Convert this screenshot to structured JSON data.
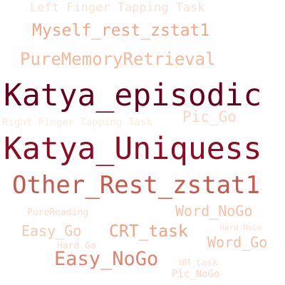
{
  "words": [
    {
      "text": "Left Finger Tapping Task",
      "color": "#fde2d3"
    },
    {
      "text": "Myself_rest_zstat1",
      "color": "#f2a587"
    },
    {
      "text": "PureMemoryRetrieval",
      "color": "#f5b89b"
    },
    {
      "text": "Katya_episodic",
      "color": "#67001f"
    },
    {
      "text": "Right Finger Tapping Task",
      "color": "#fde9df"
    },
    {
      "text": "Pic_Go",
      "color": "#fbd7c5"
    },
    {
      "text": "Katya_Uniquess",
      "color": "#8b0c23"
    },
    {
      "text": "Other_Rest_zstat1",
      "color": "#c6584b"
    },
    {
      "text": "PureReading",
      "color": "#fbdccb"
    },
    {
      "text": "Word_NoGo",
      "color": "#f6c1a6"
    },
    {
      "text": "Easy_Go",
      "color": "#f7c8b0"
    },
    {
      "text": "CRT_task",
      "color": "#f0a282"
    },
    {
      "text": "Hard_NoGo",
      "color": "#fde3d6"
    },
    {
      "text": "Word_Go",
      "color": "#f4bea2"
    },
    {
      "text": "Hard_Go",
      "color": "#fbdccd"
    },
    {
      "text": "Easy_NoGo",
      "color": "#e4826b"
    },
    {
      "text": "WM_task",
      "color": "#fde3d6"
    },
    {
      "text": "Pic_NoGo",
      "color": "#fcd8c6"
    }
  ]
}
